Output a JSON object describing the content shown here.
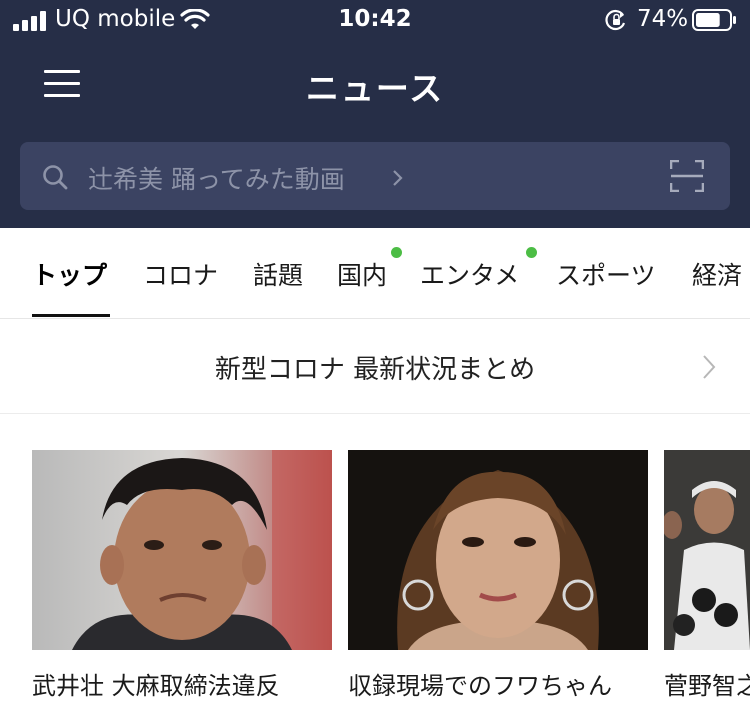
{
  "status_bar": {
    "carrier": "UQ mobile",
    "time": "10:42",
    "battery_percent": "74%",
    "battery_level": 0.74,
    "icons": [
      "cellular-signal-icon",
      "wifi-icon",
      "rotation-lock-icon",
      "battery-icon"
    ]
  },
  "header": {
    "title": "ニュース",
    "menu_icon": "hamburger-menu-icon"
  },
  "search": {
    "placeholder": "辻希美 踊ってみた動画",
    "search_icon": "search-icon",
    "trailing_icon": "scan-icon"
  },
  "tabs": [
    {
      "label": "トップ",
      "active": true,
      "dot": false
    },
    {
      "label": "コロナ",
      "active": false,
      "dot": false
    },
    {
      "label": "話題",
      "active": false,
      "dot": false
    },
    {
      "label": "国内",
      "active": false,
      "dot": true
    },
    {
      "label": "エンタメ",
      "active": false,
      "dot": true
    },
    {
      "label": "スポーツ",
      "active": false,
      "dot": false
    },
    {
      "label": "経済",
      "active": false,
      "dot": false
    }
  ],
  "banner": {
    "text": "新型コロナ 最新状況まとめ"
  },
  "articles": [
    {
      "title": "武井壮 大麻取締法違反"
    },
    {
      "title": "収録現場でのフワちゃん"
    },
    {
      "title": "菅野智之"
    }
  ],
  "colors": {
    "header_bg": "#262e47",
    "search_bg": "#3b4362",
    "notification_dot": "#4cbd45"
  }
}
